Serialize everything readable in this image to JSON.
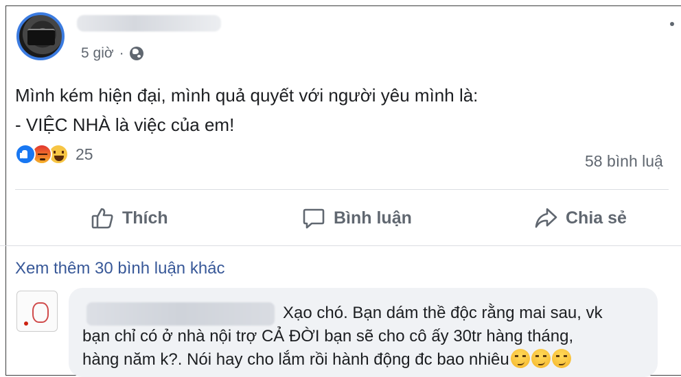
{
  "post": {
    "time": "5 giờ",
    "privacy_icon": "globe-icon",
    "text_line1": "Mình kém hiện đại, mình quả quyết với người yêu mình là:",
    "text_line2": "- VIỆC NHÀ là việc của em!"
  },
  "reactions": {
    "icons": [
      "like-reaction-icon",
      "angry-reaction-icon",
      "haha-reaction-icon"
    ],
    "count": "25",
    "comments": "58 bình luậ"
  },
  "actions": {
    "like": "Thích",
    "comment": "Bình luận",
    "share": "Chia sẻ"
  },
  "comments": {
    "view_more": "Xem thêm 30 bình luận khác",
    "first": {
      "line1": "Xạo chó. Bạn dám thề độc rằng mai sau, vk",
      "line2": "bạn chỉ có ở nhà nội trợ CẢ ĐỜI bạn sẽ cho cô ấy 30tr hàng tháng,",
      "line3": "hàng năm k?. Nói hay cho lắm rồi hành động đc bao nhiêu",
      "emoji": "smirk-emoji"
    }
  },
  "colors": {
    "accent_link": "#385898",
    "like_blue": "#1877f2",
    "muted_text": "#606770"
  }
}
